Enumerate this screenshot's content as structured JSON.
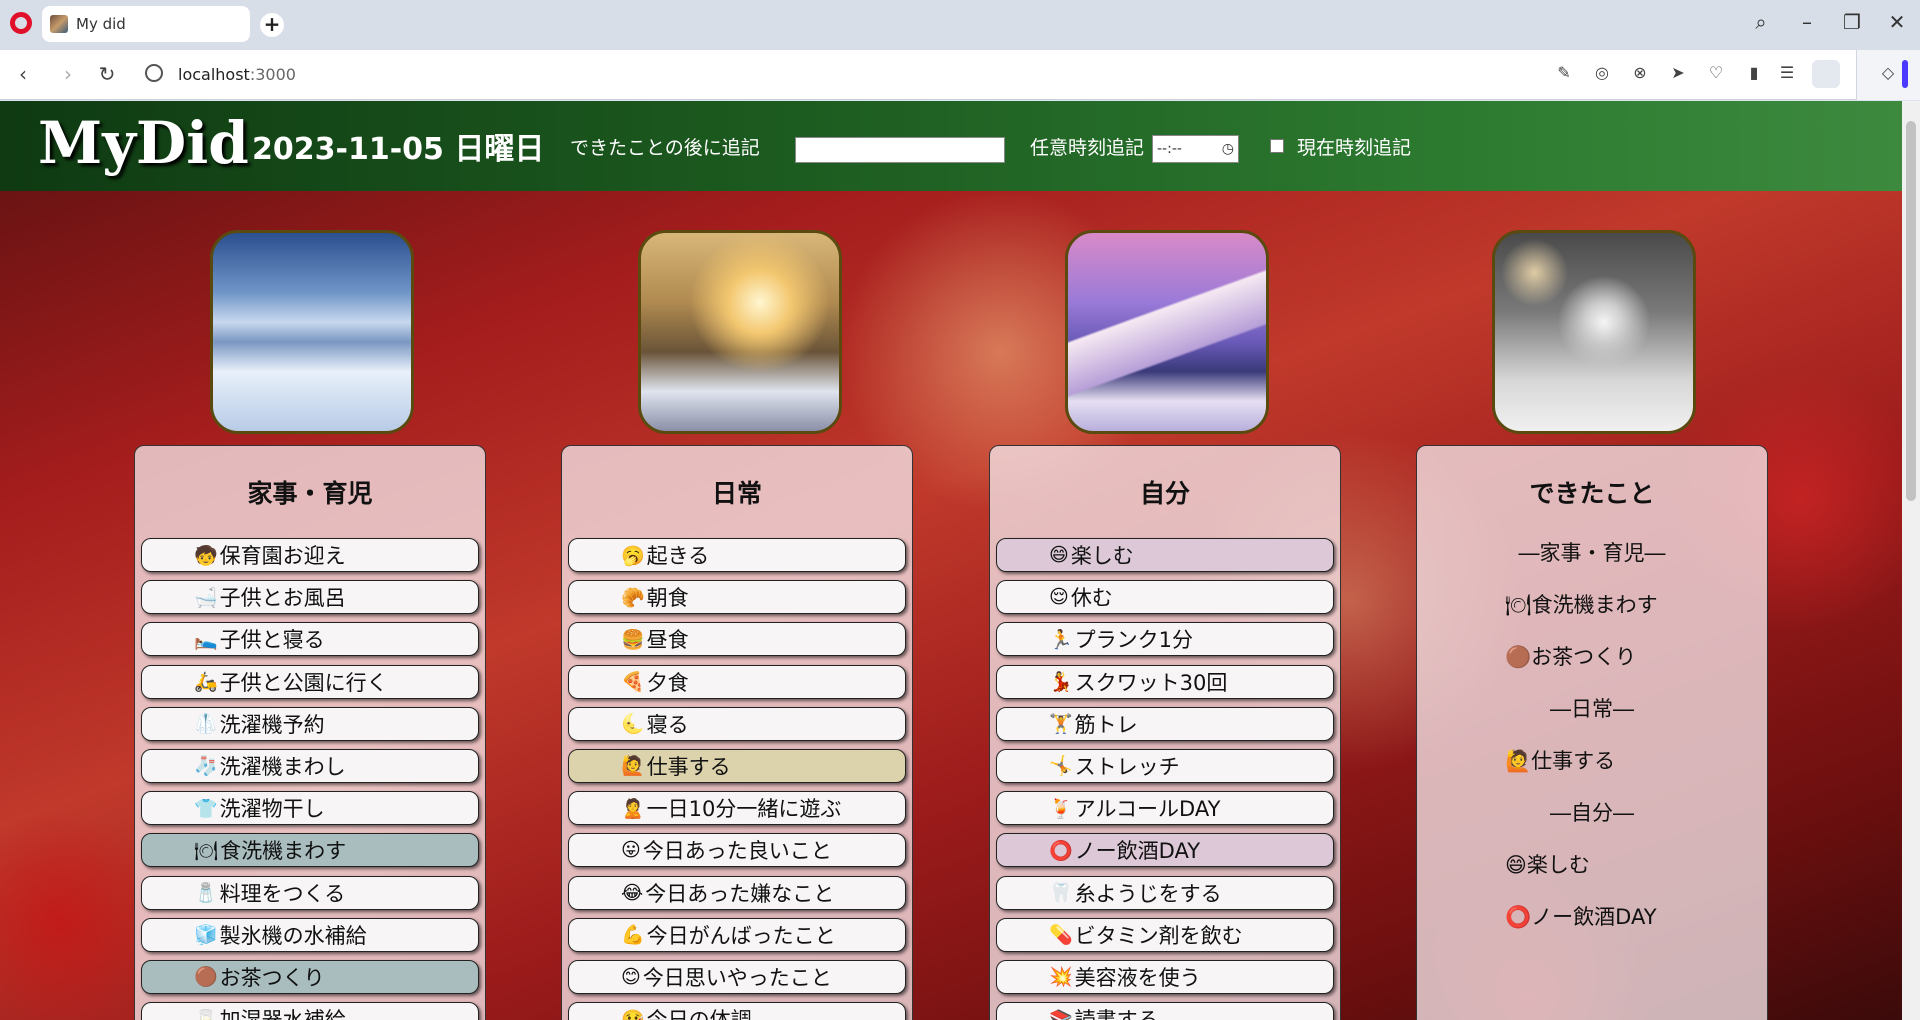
{
  "browser": {
    "tab_title": "My did",
    "new_tab": "+",
    "url_host": "localhost",
    "url_port": ":3000"
  },
  "app": {
    "logo": "MyDid",
    "date": "2023-11-05 日曜日",
    "append_after_label": "できたことの後に追記",
    "append_after_value": "",
    "optional_time_label": "任意時刻追記",
    "time_placeholder": "--:--",
    "current_time_label": "現在時刻追記"
  },
  "columns": [
    {
      "title": "家事・育児",
      "image": "snowy-village",
      "items": [
        {
          "emoji": "🧒",
          "label": "保育園お迎え",
          "selected": ""
        },
        {
          "emoji": "🛁",
          "label": "子供とお風呂",
          "selected": ""
        },
        {
          "emoji": "🛌",
          "label": "子供と寝る",
          "selected": ""
        },
        {
          "emoji": "🛵",
          "label": "子供と公園に行く",
          "selected": ""
        },
        {
          "emoji": "🥼",
          "label": "洗濯機予約",
          "selected": ""
        },
        {
          "emoji": "🧦",
          "label": "洗濯機まわし",
          "selected": ""
        },
        {
          "emoji": "👕",
          "label": "洗濯物干し",
          "selected": ""
        },
        {
          "emoji": "🍽",
          "label": "食洗機まわす",
          "selected": "gray"
        },
        {
          "emoji": "🧂",
          "label": "料理をつくる",
          "selected": ""
        },
        {
          "emoji": "🧊",
          "label": "製氷機の水補給",
          "selected": ""
        },
        {
          "emoji": "🟤",
          "label": "お茶つくり",
          "selected": "gray"
        },
        {
          "emoji": "🥛",
          "label": "加湿器水補給",
          "selected": ""
        }
      ]
    },
    {
      "title": "日常",
      "image": "winter-sunrise",
      "items": [
        {
          "emoji": "🥱",
          "label": "起きる",
          "selected": ""
        },
        {
          "emoji": "🥐",
          "label": "朝食",
          "selected": ""
        },
        {
          "emoji": "🍔",
          "label": "昼食",
          "selected": ""
        },
        {
          "emoji": "🍕",
          "label": "夕食",
          "selected": ""
        },
        {
          "emoji": "🌜",
          "label": "寝る",
          "selected": ""
        },
        {
          "emoji": "🙋",
          "label": "仕事する",
          "selected": "tan"
        },
        {
          "emoji": "🙎",
          "label": "一日10分一緒に遊ぶ",
          "selected": ""
        },
        {
          "emoji": "😛",
          "label": "今日あった良いこと",
          "selected": ""
        },
        {
          "emoji": "😂",
          "label": "今日あった嫌なこと",
          "selected": ""
        },
        {
          "emoji": "💪",
          "label": "今日がんばったこと",
          "selected": ""
        },
        {
          "emoji": "😊",
          "label": "今日思いやったこと",
          "selected": ""
        },
        {
          "emoji": "🤒",
          "label": "今日の体調",
          "selected": ""
        }
      ]
    },
    {
      "title": "自分",
      "image": "purple-mountain",
      "items": [
        {
          "emoji": "😄",
          "label": "楽しむ",
          "selected": "pink"
        },
        {
          "emoji": "😌",
          "label": "休む",
          "selected": ""
        },
        {
          "emoji": "🏃",
          "label": "プランク1分",
          "selected": ""
        },
        {
          "emoji": "💃",
          "label": "スクワット30回",
          "selected": ""
        },
        {
          "emoji": "🏋",
          "label": "筋トレ",
          "selected": ""
        },
        {
          "emoji": "🤸",
          "label": "ストレッチ",
          "selected": ""
        },
        {
          "emoji": "🍹",
          "label": "アルコールDAY",
          "selected": ""
        },
        {
          "emoji": "⭕",
          "label": "ノー飲酒DAY",
          "selected": "pink"
        },
        {
          "emoji": "🦷",
          "label": "糸ようじをする",
          "selected": ""
        },
        {
          "emoji": "💊",
          "label": "ビタミン剤を飲む",
          "selected": ""
        },
        {
          "emoji": "💥",
          "label": "美容液を使う",
          "selected": ""
        },
        {
          "emoji": "📚",
          "label": "読書する",
          "selected": ""
        }
      ]
    }
  ],
  "done": {
    "title": "できたこと",
    "image": "snowflake",
    "groups": [
      {
        "header": "―家事・育児―",
        "items": [
          {
            "emoji": "🍽",
            "label": "食洗機まわす"
          },
          {
            "emoji": "🟤",
            "label": "お茶つくり"
          }
        ]
      },
      {
        "header": "―日常―",
        "items": [
          {
            "emoji": "🙋",
            "label": "仕事する"
          }
        ]
      },
      {
        "header": "―自分―",
        "items": [
          {
            "emoji": "😄",
            "label": "楽しむ"
          },
          {
            "emoji": "⭕",
            "label": "ノー飲酒DAY"
          }
        ]
      }
    ]
  },
  "colors": {
    "header_green": "#1c5a1f",
    "selected_gray": "#a9bdbf",
    "selected_tan": "#dcd2ab",
    "selected_pink": "#dcc8d6"
  }
}
